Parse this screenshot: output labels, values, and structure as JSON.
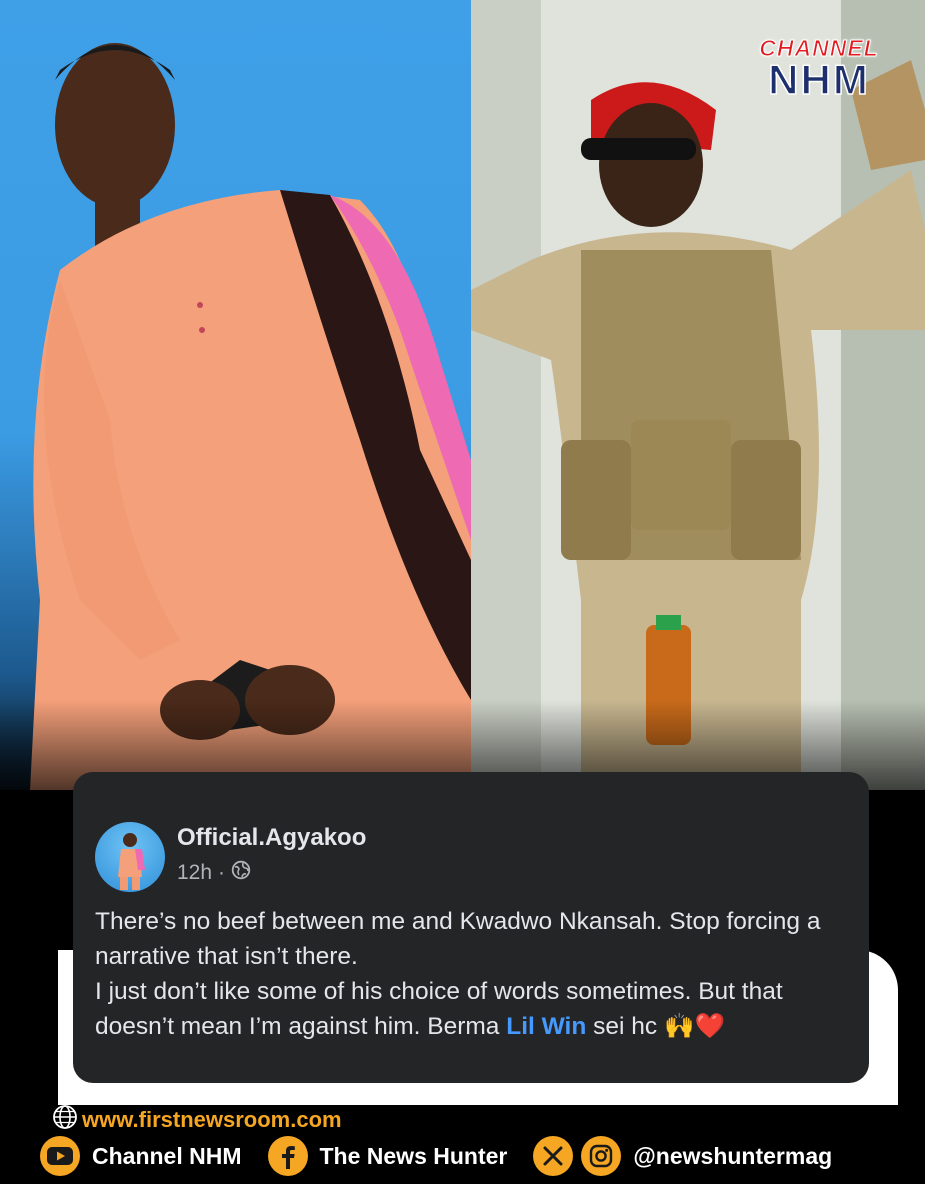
{
  "logo": {
    "line1": "CHANNEL",
    "line2": "NHM"
  },
  "post": {
    "author": "Official.Agyakoo",
    "time": "12h",
    "separator": "·",
    "line1": "There’s no beef between me and Kwadwo Nkansah. Stop forcing a narrative that isn’t there.",
    "line2_prefix": "I just don’t like some of his choice of words sometimes. But that doesn’t mean I’m against him.  Berma ",
    "mention": "Lil Win",
    "line2_suffix": "  sei hc ",
    "emoji": "🙌❤️"
  },
  "footer": {
    "website": "www.firstnewsroom.com",
    "youtube_label": "Channel NHM",
    "facebook_label": "The News Hunter",
    "handle": "@newshuntermag"
  },
  "colors": {
    "accent": "#f5a623",
    "post_bg": "#242526",
    "mention": "#4599ff",
    "logo_red": "#e11b22",
    "logo_navy": "#1e2f6d"
  }
}
